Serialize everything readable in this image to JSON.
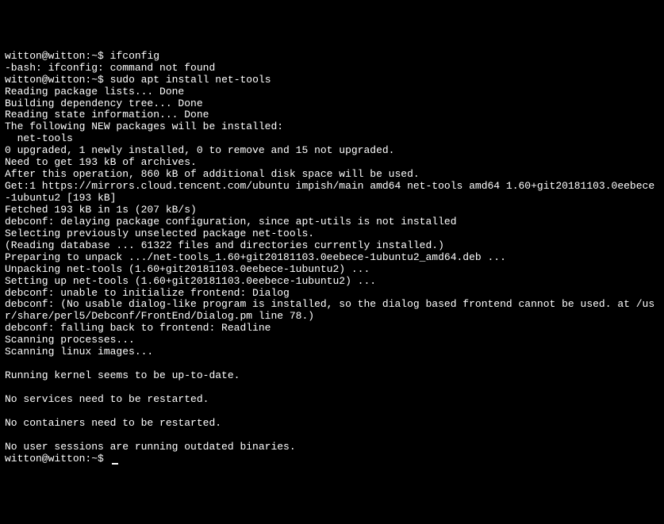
{
  "prompt1": {
    "user_host": "witton@witton",
    "sep": ":",
    "path": "~",
    "symbol": "$",
    "command": "ifconfig"
  },
  "error_line": "-bash: ifconfig: command not found",
  "prompt2": {
    "user_host": "witton@witton",
    "sep": ":",
    "path": "~",
    "symbol": "$",
    "command": "sudo apt install net-tools"
  },
  "output": [
    "Reading package lists... Done",
    "Building dependency tree... Done",
    "Reading state information... Done",
    "The following NEW packages will be installed:",
    "  net-tools",
    "0 upgraded, 1 newly installed, 0 to remove and 15 not upgraded.",
    "Need to get 193 kB of archives.",
    "After this operation, 860 kB of additional disk space will be used.",
    "Get:1 https://mirrors.cloud.tencent.com/ubuntu impish/main amd64 net-tools amd64 1.60+git20181103.0eebece-1ubuntu2 [193 kB]",
    "Fetched 193 kB in 1s (207 kB/s)",
    "debconf: delaying package configuration, since apt-utils is not installed",
    "Selecting previously unselected package net-tools.",
    "(Reading database ... 61322 files and directories currently installed.)",
    "Preparing to unpack .../net-tools_1.60+git20181103.0eebece-1ubuntu2_amd64.deb ...",
    "Unpacking net-tools (1.60+git20181103.0eebece-1ubuntu2) ...",
    "Setting up net-tools (1.60+git20181103.0eebece-1ubuntu2) ...",
    "debconf: unable to initialize frontend: Dialog",
    "debconf: (No usable dialog-like program is installed, so the dialog based frontend cannot be used. at /usr/share/perl5/Debconf/FrontEnd/Dialog.pm line 78.)",
    "debconf: falling back to frontend: Readline",
    "Scanning processes...",
    "Scanning linux images...",
    "",
    "Running kernel seems to be up-to-date.",
    "",
    "No services need to be restarted.",
    "",
    "No containers need to be restarted.",
    "",
    "No user sessions are running outdated binaries."
  ],
  "prompt3": {
    "user_host": "witton@witton",
    "sep": ":",
    "path": "~",
    "symbol": "$",
    "command": ""
  }
}
